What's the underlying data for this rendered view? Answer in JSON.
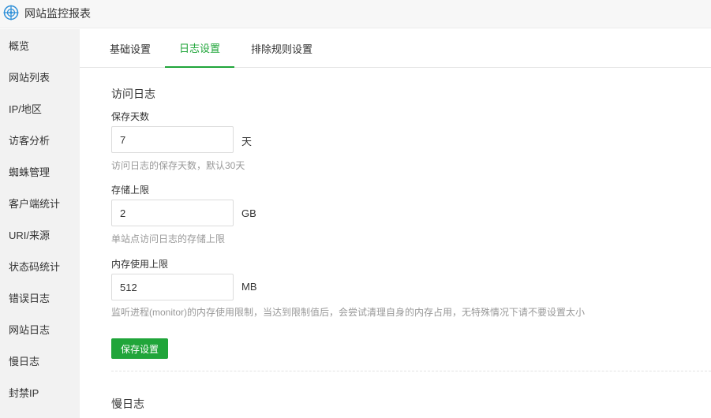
{
  "app": {
    "title": "网站监控报表",
    "logo_icon": "crosshair-globe-icon",
    "accent": "#20a53a"
  },
  "sidebar": {
    "items": [
      {
        "label": "概览"
      },
      {
        "label": "网站列表"
      },
      {
        "label": "IP/地区"
      },
      {
        "label": "访客分析"
      },
      {
        "label": "蜘蛛管理"
      },
      {
        "label": "客户端统计"
      },
      {
        "label": "URI/来源"
      },
      {
        "label": "状态码统计"
      },
      {
        "label": "错误日志"
      },
      {
        "label": "网站日志"
      },
      {
        "label": "慢日志"
      },
      {
        "label": "封禁IP"
      }
    ]
  },
  "tabs": [
    {
      "label": "基础设置",
      "active": false
    },
    {
      "label": "日志设置",
      "active": true
    },
    {
      "label": "排除规则设置",
      "active": false
    }
  ],
  "access_log": {
    "section_title": "访问日志",
    "retention": {
      "label": "保存天数",
      "value": "7",
      "unit": "天",
      "help": "访问日志的保存天数，默认30天"
    },
    "storage": {
      "label": "存储上限",
      "value": "2",
      "unit": "GB",
      "help": "单站点访问日志的存储上限"
    },
    "memory": {
      "label": "内存使用上限",
      "value": "512",
      "unit": "MB",
      "help": "监听进程(monitor)的内存使用限制，当达到限制值后，会尝试清理自身的内存占用，无特殊情况下请不要设置太小"
    },
    "save_label": "保存设置"
  },
  "slow_log": {
    "section_title": "慢日志"
  }
}
